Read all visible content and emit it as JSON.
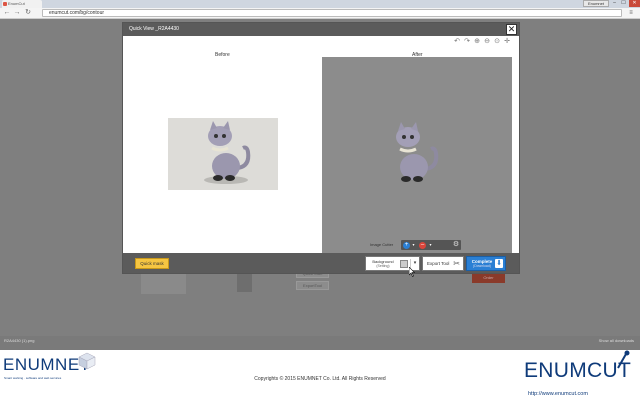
{
  "browser": {
    "tab_label": "EnumCut",
    "profile_label": "Enumnet",
    "url": "enumcut.com/bg/contour",
    "minimize": "–",
    "maximize": "☐",
    "close": "✕",
    "back_icon": "arrow-left-icon",
    "forward_icon": "arrow-right-icon",
    "reload_icon": "reload-icon",
    "menu_icon": "menu-icon"
  },
  "status_bar": {
    "download_item": "R2A4430 (1).png",
    "show_all": "Show all downloads"
  },
  "background_page": {
    "quick_start_label": "Quick Start",
    "export_label": "ExportTool",
    "order_label": "Order"
  },
  "modal": {
    "title": "Quick View _R2A4430",
    "close_glyph": "✕",
    "view_tools": [
      "undo-icon",
      "redo-icon",
      "zoom-in-icon",
      "zoom-out-icon",
      "zoom-reset-icon",
      "pan-icon"
    ],
    "view_tool_glyphs": [
      "↶",
      "↷",
      "⊕",
      "⊖",
      "⊙",
      "✛"
    ],
    "before_label": "Before",
    "after_label": "After",
    "image_cutter_label": "Image Cutter",
    "add_glyph": "+",
    "remove_glyph": "–",
    "caret_glyph": "▾",
    "gear_glyph": "⚙",
    "quick_mask_label": "Quick mask",
    "background_label": "Background",
    "background_sub": "(Setting)",
    "export_tool_label": "Export Tool",
    "export_glyph": "✂",
    "complete_label": "Complete",
    "complete_sub": "(Download)",
    "download_glyph": "⬇",
    "colors": {
      "header": "#5b5b5b",
      "quick_mask": "#f5c542",
      "complete": "#2a7fd4",
      "add": "#2a7fd4",
      "remove": "#d9453b",
      "after_background": "#8c8c8c"
    }
  },
  "footer": {
    "left_logo": "ENUMNET",
    "left_tagline": "Smart working · software and web services",
    "copyright": "Copyrights © 2015 ENUMNET Co. Ltd. All Rights Reserved",
    "right_logo": "ENUMCUT",
    "right_url": "http://www.enumcut.com"
  }
}
